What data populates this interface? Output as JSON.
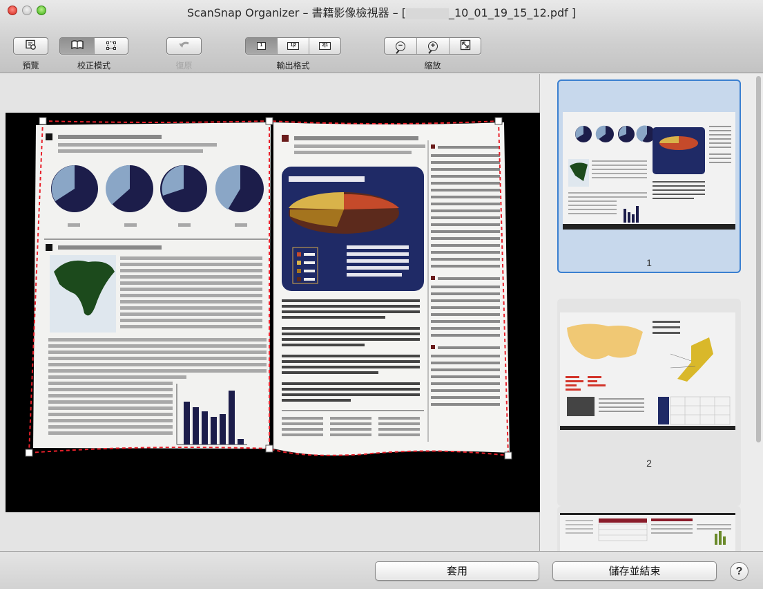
{
  "window": {
    "title_prefix": "ScanSnap Organizer – 書籍影像檢視器 – [",
    "title_suffix": "_10_01_19_15_12.pdf ]"
  },
  "toolbar": {
    "preview_label": "預覽",
    "correction_label": "校正模式",
    "undo_label": "復原",
    "output_label": "輸出格式",
    "zoom_label": "縮放",
    "output_page_1": "1",
    "output_page_12": "1|2",
    "output_page_21": "2|1",
    "zoom_out_glyph": "−",
    "zoom_in_glyph": "+"
  },
  "thumbnails": [
    {
      "number": "1",
      "selected": true
    },
    {
      "number": "2",
      "selected": false
    },
    {
      "number": "",
      "selected": false
    }
  ],
  "bottom": {
    "apply_label": "套用",
    "save_exit_label": "儲存並結束",
    "help_label": "?"
  },
  "colors": {
    "selection_border": "#3a7fd0",
    "selection_fill": "#c7d8ec",
    "crop_line": "#e8202a",
    "pie_dark": "#1c1d4a",
    "pie_light": "#8aa6c6"
  },
  "icons": [
    "preview-icon",
    "book-icon",
    "crop-corner-icon",
    "undo-icon",
    "page-single-icon",
    "page-double-icon",
    "page-double-reverse-icon",
    "zoom-out-icon",
    "zoom-in-icon",
    "fit-page-icon"
  ]
}
